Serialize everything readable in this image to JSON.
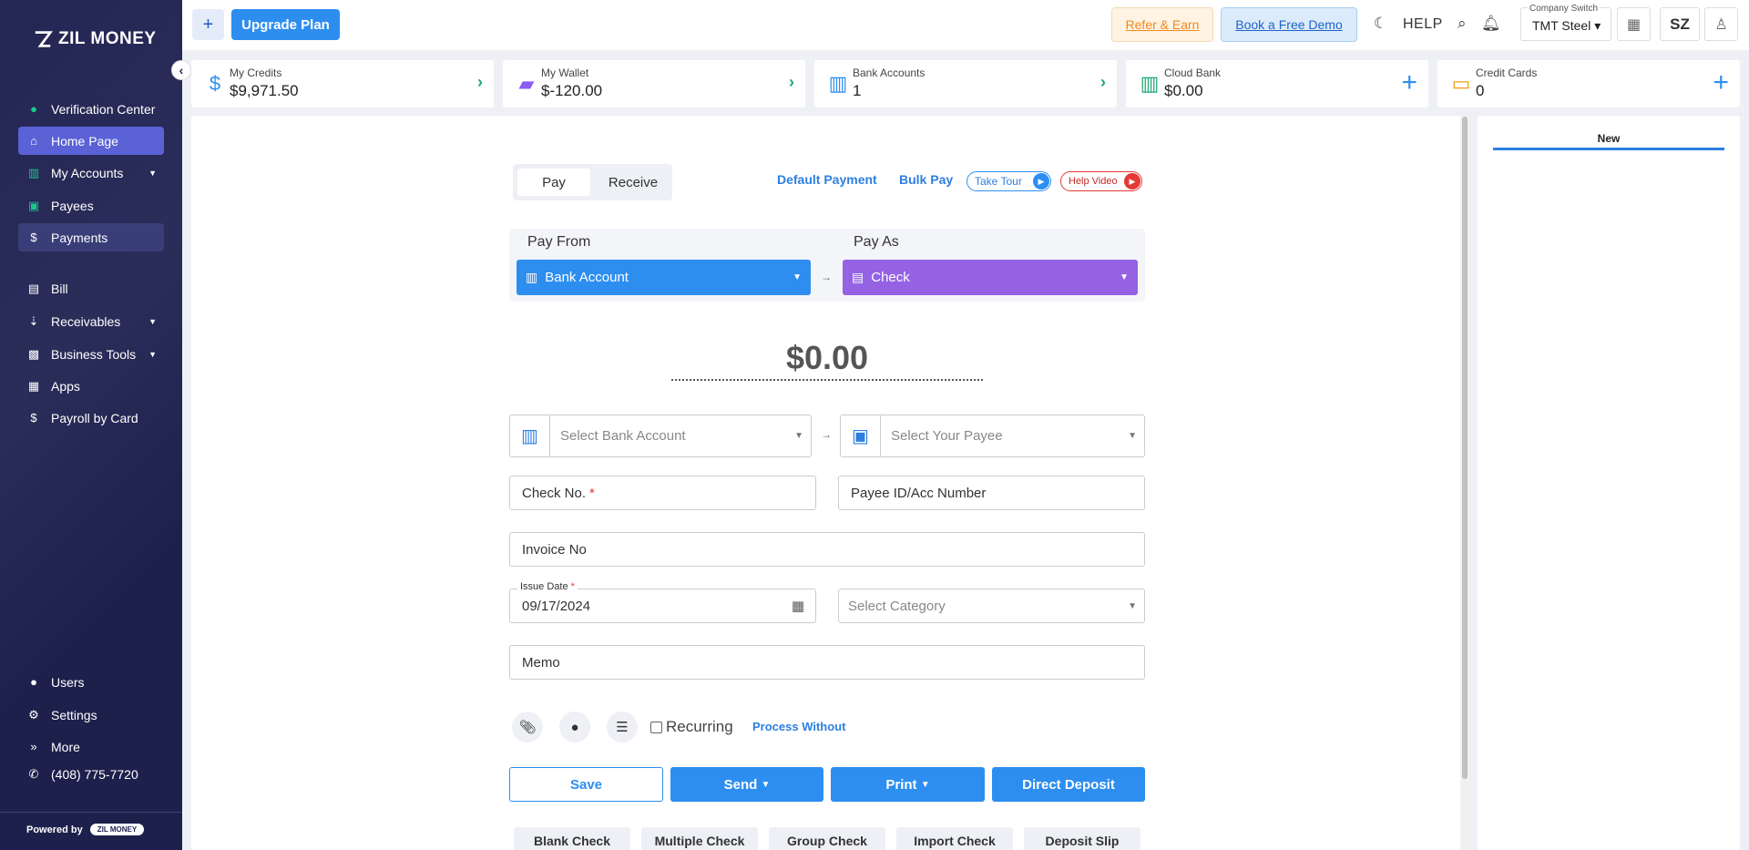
{
  "brand": {
    "name": "ZIL MONEY"
  },
  "sidebar": {
    "items": [
      {
        "label": "Verification Center",
        "icon": "check-circle-icon"
      },
      {
        "label": "Home Page",
        "icon": "home-icon"
      },
      {
        "label": "My Accounts",
        "icon": "bank-icon"
      },
      {
        "label": "Payees",
        "icon": "payee-book-icon"
      },
      {
        "label": "Payments",
        "icon": "dollar-icon"
      },
      {
        "label": "Bill",
        "icon": "bill-icon"
      },
      {
        "label": "Receivables",
        "icon": "receivables-icon"
      },
      {
        "label": "Business Tools",
        "icon": "briefcase-icon"
      },
      {
        "label": "Apps",
        "icon": "apps-grid-icon"
      },
      {
        "label": "Payroll by Card",
        "icon": "dollar-icon"
      }
    ],
    "bottom": [
      {
        "label": "Users",
        "icon": "user-icon"
      },
      {
        "label": "Settings",
        "icon": "gear-icon"
      },
      {
        "label": "More",
        "icon": "double-chevron-icon"
      },
      {
        "label": "(408) 775-7720",
        "icon": "phone-icon"
      }
    ],
    "powered_by": "Powered by",
    "powered_badge": "ZIL MONEY"
  },
  "topbar": {
    "plus": "+",
    "upgrade": "Upgrade Plan",
    "refer": "Refer & Earn",
    "demo": "Book a Free Demo",
    "help": "HELP",
    "company_label": "Company Switch",
    "company_value": "TMT Steel",
    "avatar": "SZ"
  },
  "cards": [
    {
      "title": "My Credits",
      "value": "$9,971.50",
      "icon": "dollar-icon",
      "color": "#2d8ef0",
      "action": "arrow"
    },
    {
      "title": "My Wallet",
      "value": "$-120.00",
      "icon": "wallet-icon",
      "color": "#8b5cf6",
      "action": "arrow"
    },
    {
      "title": "Bank Accounts",
      "value": "1",
      "icon": "bank-icon",
      "color": "#2d8ef0",
      "action": "arrow"
    },
    {
      "title": "Cloud Bank",
      "value": "$0.00",
      "icon": "bank-icon",
      "color": "#1da874",
      "action": "plus"
    },
    {
      "title": "Credit Cards",
      "value": "0",
      "icon": "credit-card-icon",
      "color": "#f39c12",
      "action": "plus"
    }
  ],
  "payment": {
    "tab_pay": "Pay",
    "tab_receive": "Receive",
    "default_payment": "Default Payment",
    "bulk_pay": "Bulk Pay",
    "take_tour": "Take Tour",
    "help_video": "Help Video",
    "pay_from_label": "Pay From",
    "pay_as_label": "Pay As",
    "pay_from_value": "Bank Account",
    "pay_as_value": "Check",
    "amount": "$0.00",
    "bank_placeholder": "Select Bank Account",
    "payee_placeholder": "Select Your Payee",
    "check_no": "Check No.",
    "required_mark": "*",
    "payee_id": "Payee ID/Acc Number",
    "invoice": "Invoice No",
    "issue_date_label": "Issue Date",
    "issue_date_value": "09/17/2024",
    "category_placeholder": "Select Category",
    "memo": "Memo",
    "recurring": "Recurring",
    "process_without": "Process Without"
  },
  "actions": {
    "save": "Save",
    "send": "Send",
    "print": "Print",
    "direct_deposit": "Direct Deposit"
  },
  "bottom_tabs": [
    "Blank Check",
    "Multiple Check",
    "Group Check",
    "Import Check",
    "Deposit Slip"
  ],
  "right_panel": {
    "tab": "New"
  }
}
